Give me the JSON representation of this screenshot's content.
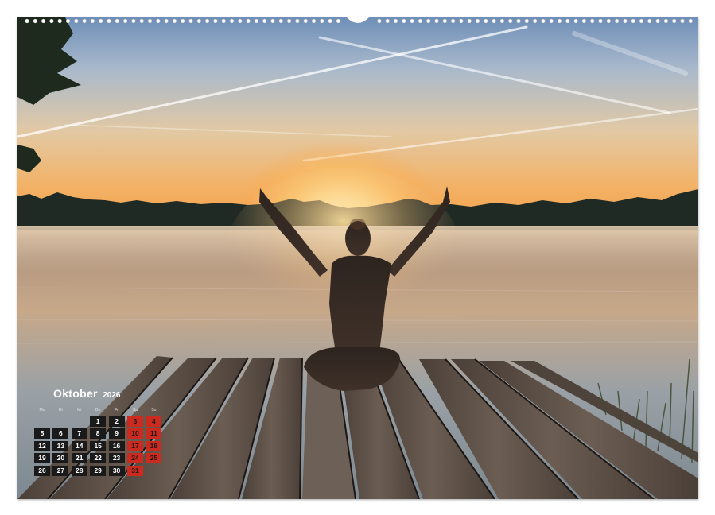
{
  "calendar": {
    "month": "Oktober",
    "year": "2026",
    "weekday_headers": [
      "Mo",
      "Di",
      "Mi",
      "Do",
      "Fr",
      "Sa",
      "So"
    ],
    "leading_blanks": 3,
    "weeks": [
      [
        "",
        "",
        "",
        "1",
        "2",
        "3",
        "4"
      ],
      [
        "5",
        "6",
        "7",
        "8",
        "9",
        "10",
        "11"
      ],
      [
        "12",
        "13",
        "14",
        "15",
        "16",
        "17",
        "18"
      ],
      [
        "19",
        "20",
        "21",
        "22",
        "23",
        "24",
        "25"
      ],
      [
        "26",
        "27",
        "28",
        "29",
        "30",
        "31",
        ""
      ]
    ],
    "weekend_color": "#cc2a1f",
    "day_cell_color": "#1a1a1a"
  },
  "photo": {
    "subject": "silhouette-meditating-on-dock",
    "scene": "sunrise-over-misty-lake"
  }
}
